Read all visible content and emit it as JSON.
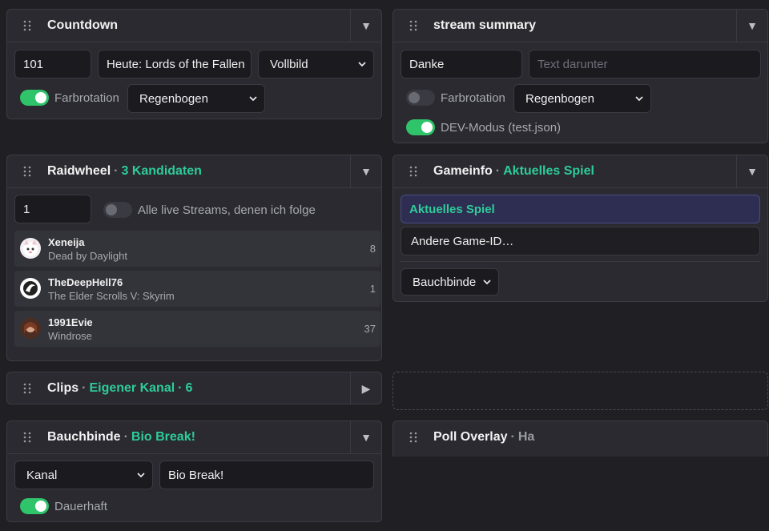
{
  "countdown": {
    "title": "Countdown",
    "toggle": "▼",
    "number_value": "101",
    "text_value": "Heute: Lords of the Fallen",
    "mode_select": "Vollbild",
    "color_rotation_label": "Farbrotation",
    "color_rotation_on": true,
    "color_select": "Regenbogen"
  },
  "stream_summary": {
    "title": "stream summary",
    "toggle": "▼",
    "text_value": "Danke",
    "subtext_placeholder": "Text darunter",
    "color_rotation_label": "Farbrotation",
    "color_rotation_on": false,
    "color_select": "Regenbogen",
    "dev_mode_label": "DEV-Modus (test.json)",
    "dev_mode_on": true
  },
  "raidwheel": {
    "title": "Raidwheel",
    "sep": "·",
    "subtitle": "3 Kandidaten",
    "toggle": "▼",
    "number_value": "1",
    "all_streams_label": "Alle live Streams, denen ich folge",
    "all_streams_on": false,
    "candidates": [
      {
        "name": "Xeneija",
        "game": "Dead by Daylight",
        "count": "8"
      },
      {
        "name": "TheDeepHell76",
        "game": "The Elder Scrolls V: Skyrim",
        "count": "1"
      },
      {
        "name": "1991Evie",
        "game": "Windrose",
        "count": "37"
      }
    ]
  },
  "gameinfo": {
    "title": "Gameinfo",
    "sep": "·",
    "subtitle": "Aktuelles Spiel",
    "toggle": "▼",
    "option_current": "Aktuelles Spiel",
    "option_other": "Andere Game-ID…",
    "target_select": "Bauchbinde"
  },
  "clips": {
    "title": "Clips",
    "sep": "·",
    "subtitle": "Eigener Kanal",
    "sep2": "·",
    "count": "6",
    "toggle": "▶"
  },
  "bauchbinde": {
    "title": "Bauchbinde",
    "sep": "·",
    "subtitle": "Bio Break!",
    "toggle": "▼",
    "type_select": "Kanal",
    "text_value": "Bio Break!",
    "permanent_label": "Dauerhaft",
    "permanent_on": true
  },
  "poll_overlay": {
    "title": "Poll Overlay",
    "sep": "·",
    "subtitle": "Ha"
  },
  "colors": {
    "background": "#1f1f24",
    "panel": "#2a2a30",
    "accent": "#2ecc9a",
    "switch_on": "#2fc36a",
    "active_option_bg": "#2e2e52"
  },
  "icons": [
    "drag-handle-icon",
    "chevron-down-icon",
    "chevron-right-icon",
    "select-chevron-icon"
  ]
}
